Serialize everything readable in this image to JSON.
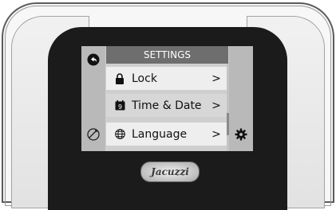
{
  "screen": {
    "title": "SETTINGS",
    "items": [
      {
        "label": "Lock",
        "icon": "lock-icon"
      },
      {
        "label": "Time & Date",
        "icon": "calendar-icon",
        "icon_text": "9"
      },
      {
        "label": "Language",
        "icon": "globe-icon"
      }
    ],
    "chevron": ">",
    "scroll_position_fraction": 0.75
  },
  "left_buttons": {
    "top": "back-icon",
    "bottom": "rotate-icon"
  },
  "right_buttons": {
    "bottom": "gear-icon"
  },
  "brand": {
    "logo_text": "Jacuzzi"
  },
  "colors": {
    "bezel": "#1b1b1b",
    "header": "#6e6e6e",
    "side_columns": "#b9b9b9",
    "row_light": "#eeeeee",
    "row_selected": "#d7d7d7"
  }
}
